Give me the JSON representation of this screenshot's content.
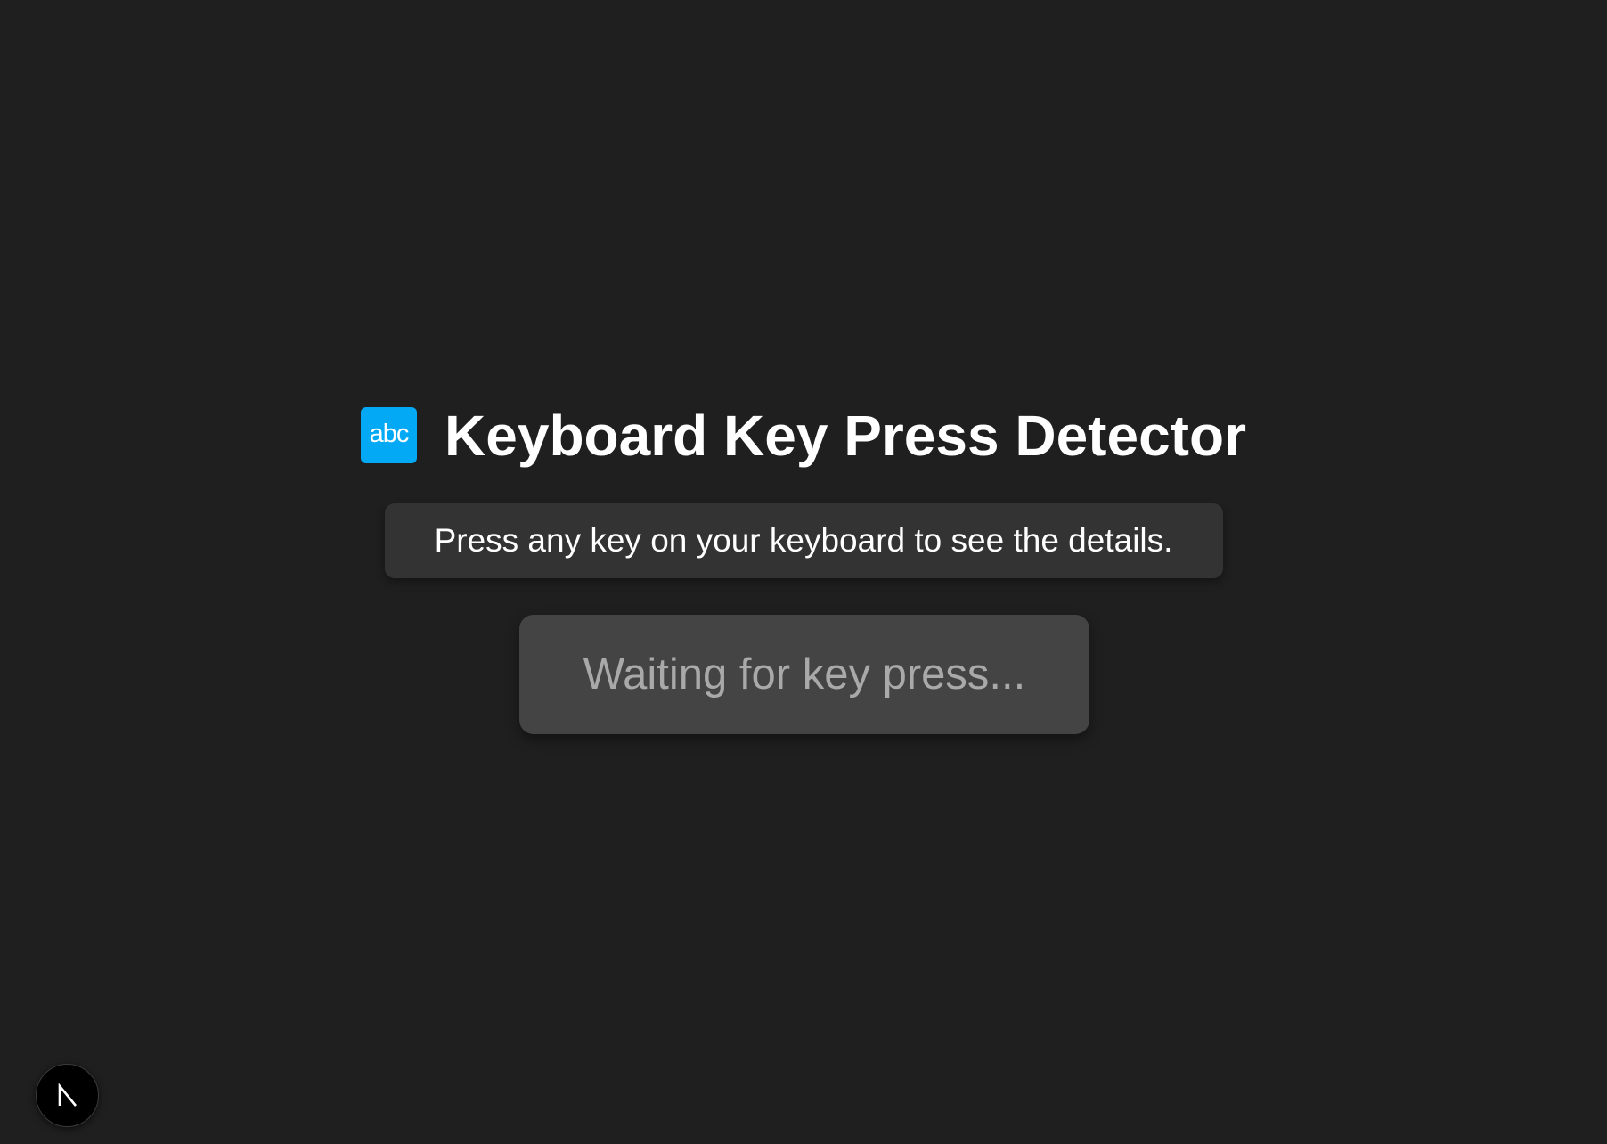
{
  "header": {
    "icon": "abc-icon",
    "icon_text": "abc",
    "title": "Keyboard Key Press Detector"
  },
  "instructions": {
    "text": "Press any key on your keyboard to see the details."
  },
  "key_display": {
    "status_text": "Waiting for key press..."
  },
  "dev_tools": {
    "icon": "nextjs-logo-icon"
  },
  "colors": {
    "background": "#1f1f1f",
    "icon_accent": "#03a9f4",
    "instructions_panel": "#333333",
    "key_panel": "#444444",
    "waiting_text": "#a9a9a9"
  }
}
